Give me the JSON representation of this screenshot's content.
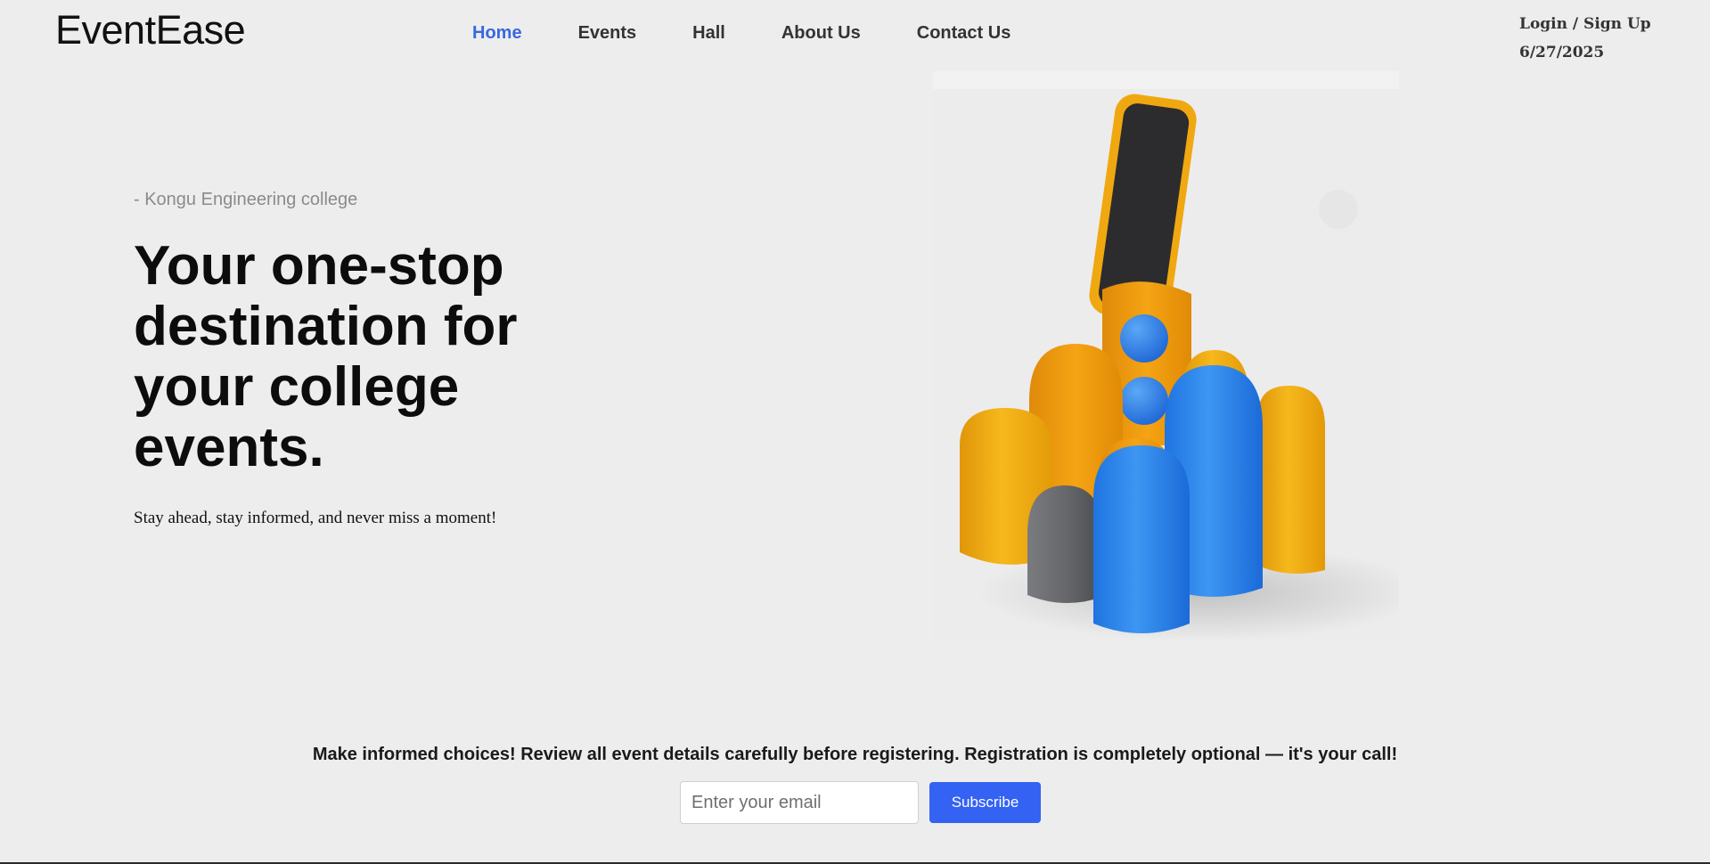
{
  "header": {
    "logo": "EventEase",
    "nav": [
      {
        "label": "Home",
        "active": true
      },
      {
        "label": "Events",
        "active": false
      },
      {
        "label": "Hall",
        "active": false
      },
      {
        "label": "About Us",
        "active": false
      },
      {
        "label": "Contact Us",
        "active": false
      }
    ],
    "login_label": "Login / Sign Up",
    "date": "6/27/2025"
  },
  "hero": {
    "kicker": "- Kongu Engineering college",
    "headline": "Your one-stop destination for your college events.",
    "subtext": "Stay ahead, stay informed, and never miss a moment!",
    "image_icon": "phone-with-3d-shapes-illustration"
  },
  "newsletter": {
    "notice": "Make informed choices! Review all event details carefully before registering. Registration is completely optional — it's your call!",
    "email_placeholder": "Enter your email",
    "email_value": "",
    "subscribe_label": "Subscribe"
  },
  "colors": {
    "background": "#ededed",
    "accent": "#3462f2",
    "nav_active": "#3a67e0",
    "shape_yellow": "#f2ad12",
    "shape_blue": "#2e86ec",
    "shape_gray": "#5c5d60"
  }
}
